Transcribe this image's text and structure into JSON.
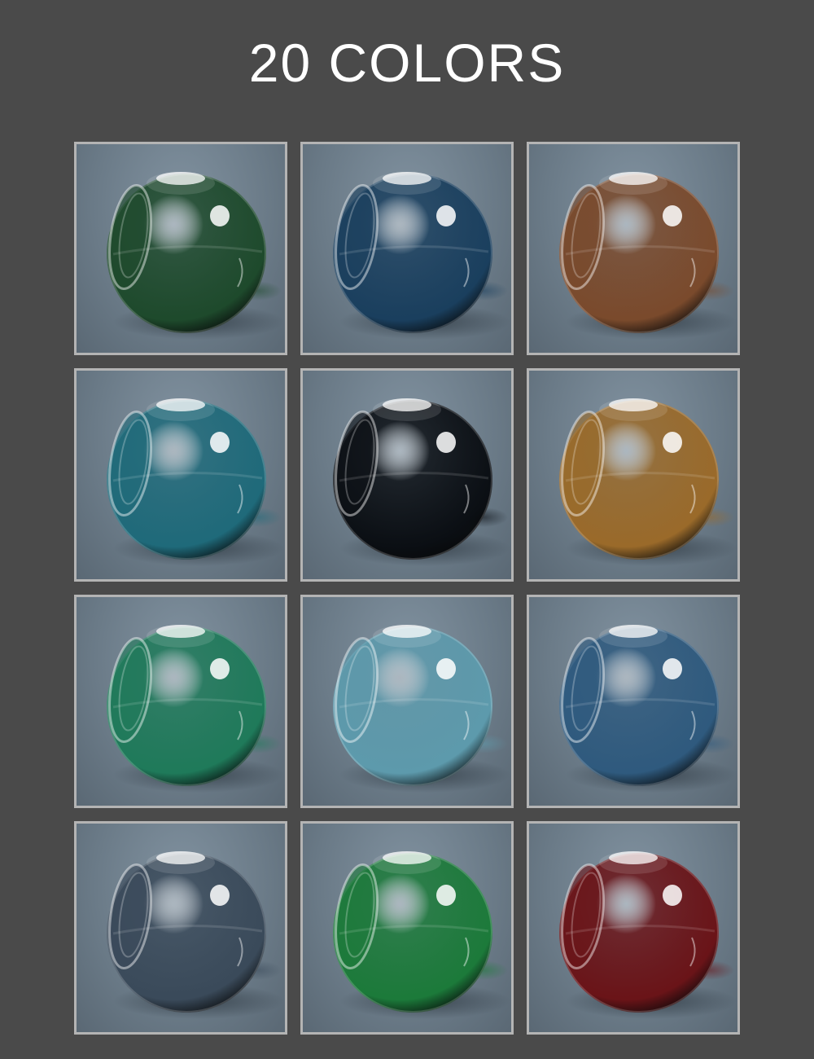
{
  "title": "20 COLORS",
  "swatches": [
    {
      "name": "green",
      "color": "#1e4a2c"
    },
    {
      "name": "blue",
      "color": "#1a3f5e"
    },
    {
      "name": "bronze",
      "color": "#7a4a2c"
    },
    {
      "name": "teal",
      "color": "#1f6a7a"
    },
    {
      "name": "black",
      "color": "#0b0f14"
    },
    {
      "name": "amber",
      "color": "#9a6a2a"
    },
    {
      "name": "emerald",
      "color": "#1f7a5a"
    },
    {
      "name": "light-blue",
      "color": "#5d9aac"
    },
    {
      "name": "steel-blue",
      "color": "#2f5a7e"
    },
    {
      "name": "smoke-gray",
      "color": "#3a4a5a"
    },
    {
      "name": "bright-green",
      "color": "#1c7a3a"
    },
    {
      "name": "red",
      "color": "#6a1418"
    }
  ]
}
